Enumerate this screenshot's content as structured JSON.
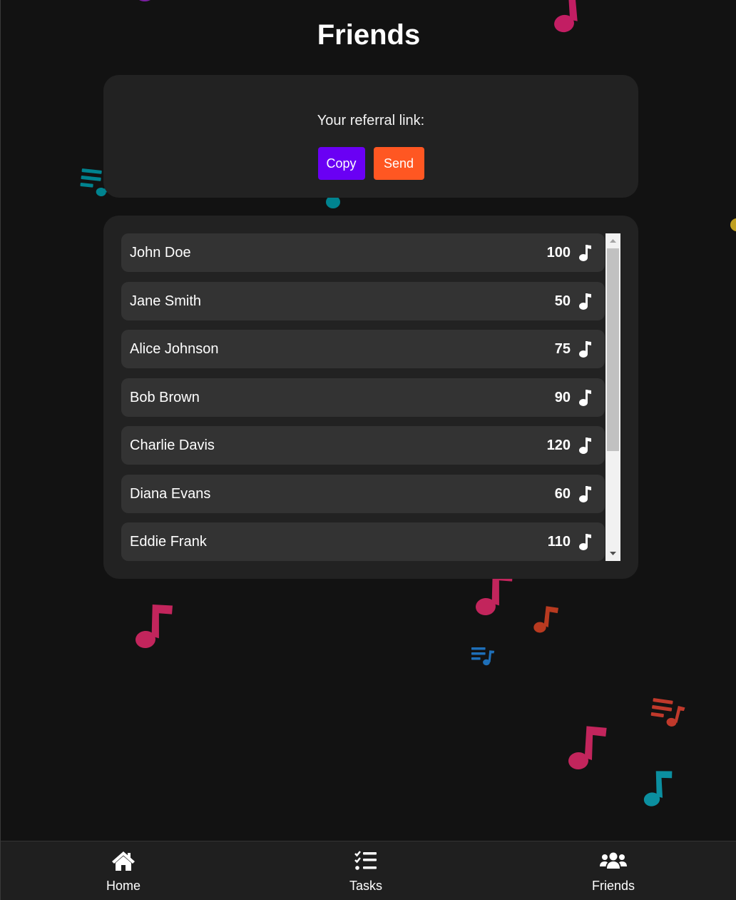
{
  "page": {
    "title": "Friends"
  },
  "referral": {
    "label": "Your referral link:",
    "copy_label": "Copy",
    "send_label": "Send"
  },
  "friends": [
    {
      "name": "John Doe",
      "score": "100"
    },
    {
      "name": "Jane Smith",
      "score": "50"
    },
    {
      "name": "Alice Johnson",
      "score": "75"
    },
    {
      "name": "Bob Brown",
      "score": "90"
    },
    {
      "name": "Charlie Davis",
      "score": "120"
    },
    {
      "name": "Diana Evans",
      "score": "60"
    },
    {
      "name": "Eddie Frank",
      "score": "110"
    }
  ],
  "nav": {
    "home_label": "Home",
    "tasks_label": "Tasks",
    "friends_label": "Friends"
  },
  "icons": {
    "score": "music-note-icon",
    "home": "home-icon",
    "tasks": "tasks-list-icon",
    "friends": "users-icon"
  },
  "colors": {
    "background": "#121212",
    "card": "#222222",
    "row": "#333333",
    "copy_button": "#6a00f4",
    "send_button": "#ff5722",
    "nav_bar": "#1f1f1f"
  }
}
